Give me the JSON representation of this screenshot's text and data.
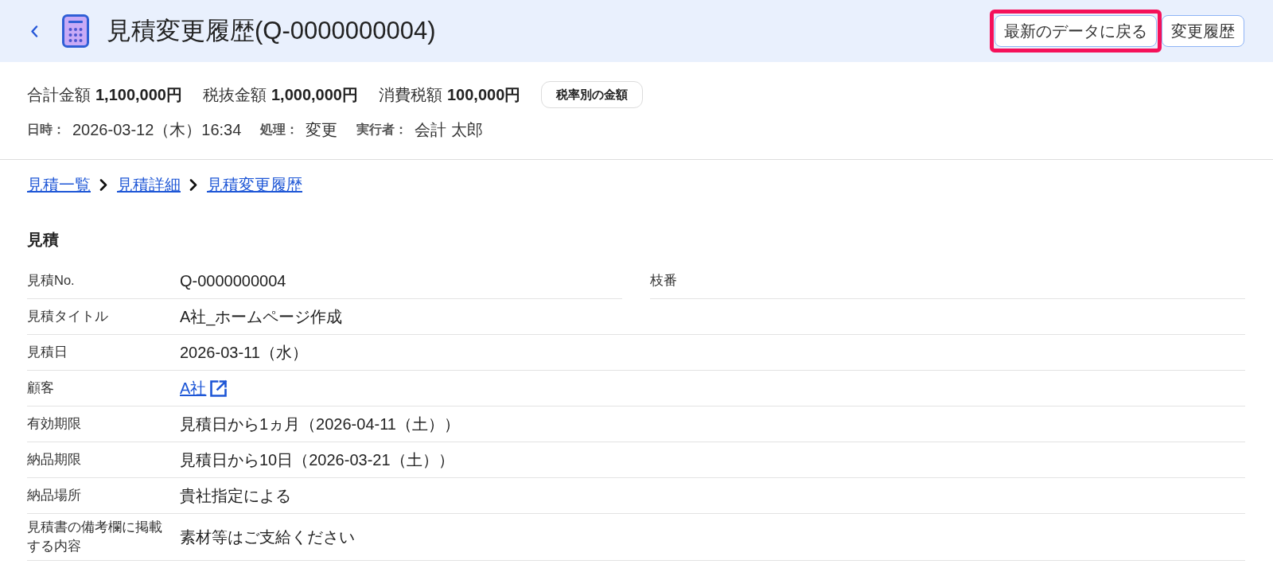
{
  "header": {
    "title": "見積変更履歴(Q-0000000004)",
    "buttons": [
      {
        "label": "最新のデータに戻る",
        "highlighted": true
      },
      {
        "label": "変更履歴",
        "highlighted": false
      }
    ]
  },
  "summary": {
    "amounts": [
      {
        "label": "合計金額",
        "value": "1,100,000円"
      },
      {
        "label": "税抜金額",
        "value": "1,000,000円"
      },
      {
        "label": "消費税額",
        "value": "100,000円"
      }
    ],
    "tax_button": "税率別の金額",
    "meta": [
      {
        "label": "日時：",
        "value": "2026-03-12（木）16:34"
      },
      {
        "label": "処理：",
        "value": "変更"
      },
      {
        "label": "実行者：",
        "value": "会計 太郎"
      }
    ]
  },
  "breadcrumb": [
    {
      "label": "見積一覧"
    },
    {
      "label": "見積詳細"
    },
    {
      "label": "見積変更履歴"
    }
  ],
  "section": {
    "title": "見積",
    "rows": [
      {
        "cells": [
          {
            "label": "見積No.",
            "value": "Q-0000000004",
            "kind": "text"
          },
          {
            "label": "枝番"
          }
        ]
      },
      {
        "cells": [
          {
            "label": "見積タイトル",
            "value": "A社_ホームページ作成",
            "kind": "text"
          }
        ]
      },
      {
        "cells": [
          {
            "label": "見積日",
            "value": "2026-03-11（水）",
            "kind": "text"
          }
        ]
      },
      {
        "cells": [
          {
            "label": "顧客",
            "value": "A社",
            "kind": "link"
          }
        ]
      },
      {
        "cells": [
          {
            "label": "有効期限",
            "value": "見積日から1ヵ月（2026-04-11（土））",
            "kind": "text"
          }
        ]
      },
      {
        "cells": [
          {
            "label": "納品期限",
            "value": "見積日から10日（2026-03-21（土））",
            "kind": "text"
          }
        ]
      },
      {
        "cells": [
          {
            "label": "納品場所",
            "value": "貴社指定による",
            "kind": "text"
          }
        ]
      },
      {
        "cells": [
          {
            "label": "見積書の備考欄に掲載する内容",
            "value": "素材等はご支給ください",
            "kind": "text"
          }
        ]
      }
    ]
  }
}
